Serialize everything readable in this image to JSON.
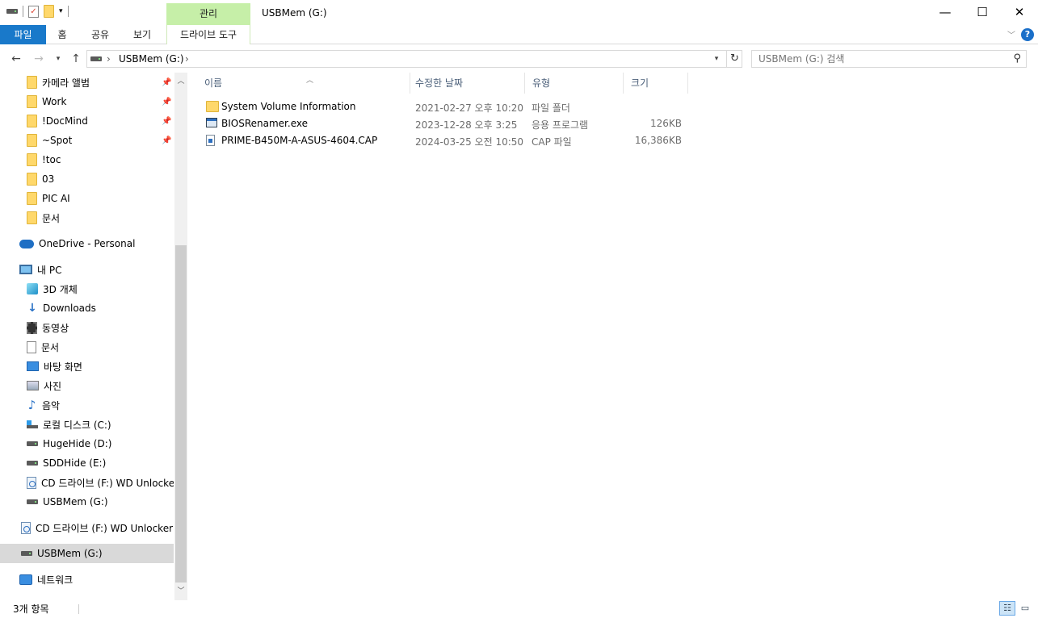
{
  "window": {
    "title": "USBMem (G:)",
    "context_tab_group": "관리",
    "minimize": "—",
    "maximize": "☐",
    "close": "✕"
  },
  "ribbon": {
    "tabs": [
      "파일",
      "홈",
      "공유",
      "보기"
    ],
    "context_tab": "드라이브 도구"
  },
  "address": {
    "crumbs": [
      "USBMem (G:)"
    ],
    "search_placeholder": "USBMem (G:) 검색"
  },
  "nav": {
    "quick_access": [
      {
        "label": "카메라 앨범",
        "pinned": true
      },
      {
        "label": "Work",
        "pinned": true
      },
      {
        "label": "!DocMind",
        "pinned": true
      },
      {
        "label": "~Spot",
        "pinned": true
      },
      {
        "label": "!toc",
        "pinned": false
      },
      {
        "label": "03",
        "pinned": false
      },
      {
        "label": "PIC AI",
        "pinned": false
      },
      {
        "label": "문서",
        "pinned": false
      }
    ],
    "onedrive": "OneDrive - Personal",
    "this_pc": "내 PC",
    "pc_items": [
      {
        "label": "3D 개체",
        "icon": "cube-icon"
      },
      {
        "label": "Downloads",
        "icon": "download-icon"
      },
      {
        "label": "동영상",
        "icon": "video-icon"
      },
      {
        "label": "문서",
        "icon": "document-icon"
      },
      {
        "label": "바탕 화면",
        "icon": "desktop-icon"
      },
      {
        "label": "사진",
        "icon": "pictures-icon"
      },
      {
        "label": "음악",
        "icon": "music-icon"
      },
      {
        "label": "로컬 디스크 (C:)",
        "icon": "system-drive-icon"
      },
      {
        "label": "HugeHide (D:)",
        "icon": "drive-icon"
      },
      {
        "label": "SDDHide (E:)",
        "icon": "drive-icon"
      },
      {
        "label": "CD 드라이브 (F:) WD Unlocker",
        "icon": "cd-drive-icon"
      },
      {
        "label": "USBMem (G:)",
        "icon": "drive-icon"
      }
    ],
    "cd_root": "CD 드라이브 (F:) WD Unlocker",
    "usb_root": "USBMem (G:)",
    "network": "네트워크"
  },
  "columns": {
    "name": "이름",
    "date": "수정한 날짜",
    "type": "유형",
    "size": "크기"
  },
  "files": [
    {
      "name": "System Volume Information",
      "date": "2021-02-27 오후 10:20",
      "type": "파일 폴더",
      "size": "",
      "icon": "folder-icon"
    },
    {
      "name": "BIOSRenamer.exe",
      "date": "2023-12-28 오후 3:25",
      "type": "응용 프로그램",
      "size": "126KB",
      "icon": "exe-icon"
    },
    {
      "name": "PRIME-B450M-A-ASUS-4604.CAP",
      "date": "2024-03-25 오전 10:50",
      "type": "CAP 파일",
      "size": "16,386KB",
      "icon": "cap-file-icon"
    }
  ],
  "status": {
    "item_count": "3개 항목"
  },
  "colors": {
    "file_tab": "#1979ca",
    "context_tab": "#c6efa8",
    "selected_nav": "#d9d9d9",
    "header_text": "#4c607a"
  }
}
